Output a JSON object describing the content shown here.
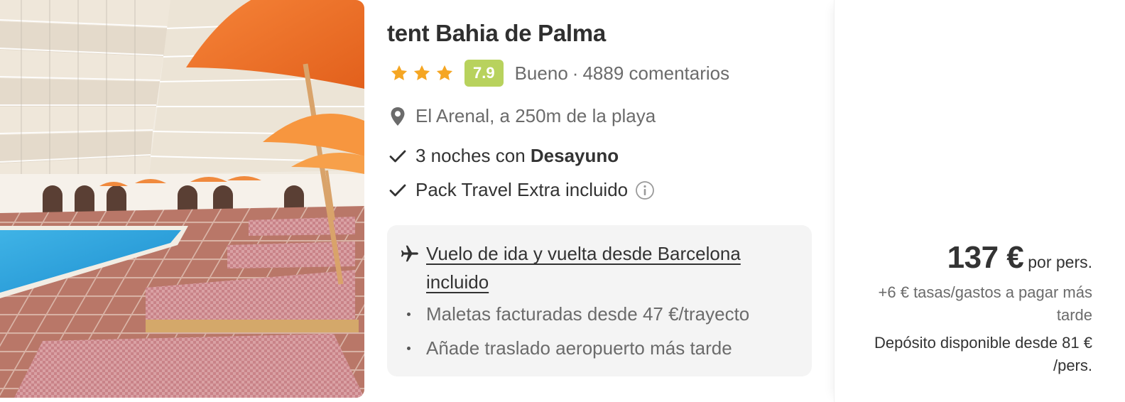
{
  "hotel": {
    "title": "tent Bahia de Palma",
    "stars": 3,
    "score": "7.9",
    "rating_label": "Bueno",
    "rating_separator": "·",
    "reviews": "4889 comentarios",
    "location": "El Arenal, a 250m de la playa",
    "features": [
      {
        "prefix": "3 noches con ",
        "bold": "Desayuno"
      },
      {
        "prefix": "Pack Travel Extra incluido",
        "bold": ""
      }
    ]
  },
  "flight": {
    "link": "Vuelo de ida y vuelta desde Barcelona incluido",
    "bullets": [
      "Maletas facturadas desde 47 €/trayecto",
      "Añade traslado aeropuerto más tarde"
    ]
  },
  "price": {
    "amount": "137 €",
    "unit": "por pers.",
    "taxes": "+6 € tasas/gastos a pagar más tarde",
    "deposit": "Depósito disponible desde 81 € /pers."
  },
  "colors": {
    "star": "#f5a623",
    "score_badge": "#b8d25d",
    "flight_box_bg": "#f4f4f4"
  },
  "icons": {
    "location": "map-pin-icon",
    "check": "checkmark-icon",
    "info": "info-circle-icon",
    "plane": "airplane-icon",
    "star": "star-icon"
  }
}
